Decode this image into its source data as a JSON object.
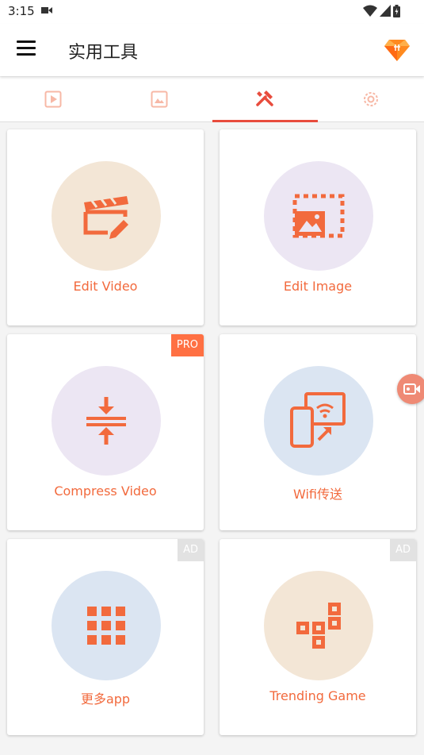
{
  "status": {
    "time": "3:15"
  },
  "app": {
    "title": "实用工具"
  },
  "tabs": [
    {
      "name": "video-tab",
      "icon": "video-play-icon"
    },
    {
      "name": "image-tab",
      "icon": "image-icon"
    },
    {
      "name": "tools-tab",
      "icon": "tools-icon",
      "active": true
    },
    {
      "name": "settings-tab",
      "icon": "gear-icon"
    }
  ],
  "tools": [
    {
      "label": "Edit Video",
      "icon": "clapperboard-edit-icon",
      "bg": "#f3e6d6"
    },
    {
      "label": "Edit Image",
      "icon": "image-crop-icon",
      "bg": "#ece6f3"
    },
    {
      "label": "Compress Video",
      "icon": "compress-icon",
      "bg": "#ece6f3",
      "badge": "PRO"
    },
    {
      "label": "Wifi传送",
      "icon": "wifi-transfer-icon",
      "bg": "#dbe5f2"
    },
    {
      "label": "更多app",
      "icon": "grid-apps-icon",
      "bg": "#dbe5f2",
      "badge": "AD"
    },
    {
      "label": "Trending Game",
      "icon": "blocks-game-icon",
      "bg": "#f3e6d6",
      "badge": "AD"
    }
  ],
  "colors": {
    "accent": "#f26a3d",
    "tab_active": "#e84c3d",
    "pro_badge": "#ff7043"
  }
}
